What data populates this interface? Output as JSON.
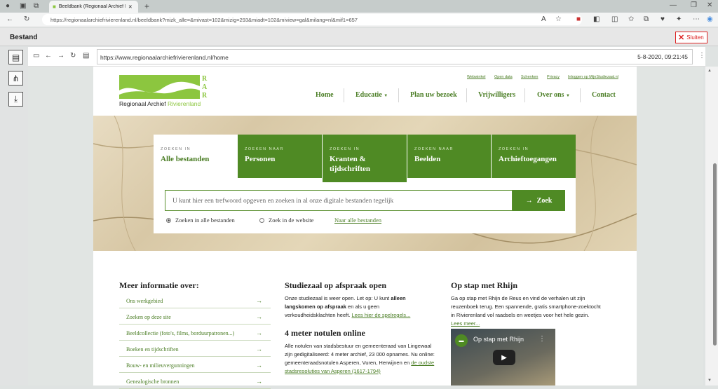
{
  "browser": {
    "tab_title": "Beeldbank (Regionaal Archief Riv",
    "address": "https://regionaalarchiefrivierenland.nl/beeldbank?mizk_alle=&mivast=102&mizig=293&miadt=102&miview=gal&milang=nl&mif1=657"
  },
  "viewer": {
    "title": "Bestand",
    "close_label": "Sluiten",
    "inner_url": "https://www.regionaalarchiefrivierenland.nl/home",
    "timestamp": "5-8-2020, 09:21:45"
  },
  "site": {
    "logo_letters": "RAR",
    "logo_text_1": "Regionaal Archief",
    "logo_text_2": "Rivierenland",
    "top_links": [
      "Webwinkel",
      "Open data",
      "Schenken",
      "Privacy",
      "Inloggen op MijnStudiezaal.nl"
    ],
    "nav": [
      "Home",
      "Educatie",
      "Plan uw bezoek",
      "Vrijwilligers",
      "Over ons",
      "Contact"
    ],
    "search_tabs": [
      {
        "small": "ZOEKEN IN",
        "big": "Alle bestanden"
      },
      {
        "small": "ZOEKEN NAAR",
        "big": "Personen"
      },
      {
        "small": "ZOEKEN IN",
        "big": "Kranten & tijdschriften"
      },
      {
        "small": "ZOEKEN NAAR",
        "big": "Beelden"
      },
      {
        "small": "ZOEKEN IN",
        "big": "Archieftoegangen"
      }
    ],
    "search_placeholder": "U kunt hier een trefwoord opgeven en zoeken in al onze digitale bestanden tegelijk",
    "search_button": "Zoek",
    "radio_1": "Zoeken in alle bestanden",
    "radio_2": "Zoek in de website",
    "all_files_link": "Naar alle bestanden",
    "col1_title": "Meer informatie over:",
    "col1_items": [
      "Ons werkgebied",
      "Zoeken op deze site",
      "Beeldcollectie (foto's, films, borduurpatronen...)",
      "Boeken en tijdschriften",
      "Bouw- en milieuvergunningen",
      "Genealogische bronnen"
    ],
    "col2_title": "Studiezaal op afspraak open",
    "col2_text_a": "Onze studiezaal is weer open. Let op: U kunt ",
    "col2_text_bold": "alleen langskomen op afspraak",
    "col2_text_b": " en als u geen verkoudheidsklachten heeft. ",
    "col2_link": "Lees hier de spelregels...",
    "col2_title2": "4 meter notulen online",
    "col2_text2": "Alle notulen van stadsbestuur en gemeenteraad van Lingewaal zijn gedigitaliseerd: 4 meter archief, 23 000 opnames. Nu online: gemeenteraadsnotulen Asperen, Vuren, Herwijnen en ",
    "col2_link2": "de oudste stadsresoluties van Asperen (1617-1794)",
    "col3_title": "Op stap met Rhijn",
    "col3_text": "Ga op stap met Rhijn de Reus en vind de verhalen uit zijn reuzenboek terug. Een spannende, gratis smartphone-zoektocht in Rivierenland vol raadsels en weetjes voor het hele gezin. ",
    "col3_link": "Lees meer...",
    "video_title": "Op stap met Rhijn"
  },
  "colors": {
    "brand_green": "#4f8a24",
    "logo_green": "#8cc63f"
  }
}
